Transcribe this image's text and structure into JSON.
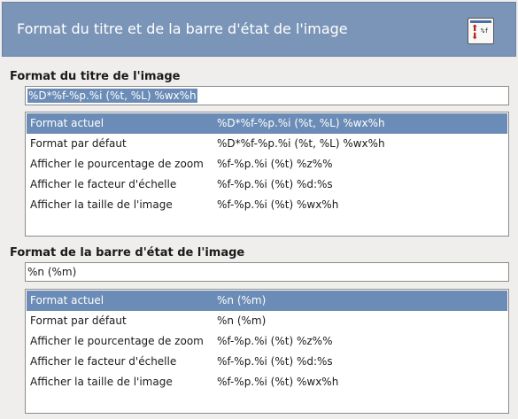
{
  "banner": {
    "title": "Format du titre et de la barre d'état de l'image",
    "icon": "title-format-icon"
  },
  "title_section": {
    "label": "Format du titre de l'image",
    "input_value": "%D*%f-%p.%i (%t, %L) %wx%h",
    "rows": [
      {
        "name": "Format actuel",
        "value": "%D*%f-%p.%i (%t, %L) %wx%h"
      },
      {
        "name": "Format par défaut",
        "value": "%D*%f-%p.%i (%t, %L) %wx%h"
      },
      {
        "name": "Afficher le pourcentage de zoom",
        "value": "%f-%p.%i (%t) %z%%"
      },
      {
        "name": "Afficher le facteur d'échelle",
        "value": "%f-%p.%i (%t) %d:%s"
      },
      {
        "name": "Afficher la taille de l'image",
        "value": "%f-%p.%i (%t) %wx%h"
      }
    ]
  },
  "status_section": {
    "label": "Format de la barre d'état de l'image",
    "input_value": "%n (%m)",
    "rows": [
      {
        "name": "Format actuel",
        "value": "%n (%m)"
      },
      {
        "name": "Format par défaut",
        "value": "%n (%m)"
      },
      {
        "name": "Afficher le pourcentage de zoom",
        "value": "%f-%p.%i (%t) %z%%"
      },
      {
        "name": "Afficher le facteur d'échelle",
        "value": "%f-%p.%i (%t) %d:%s"
      },
      {
        "name": "Afficher la taille de l'image",
        "value": "%f-%p.%i (%t) %wx%h"
      }
    ]
  },
  "colors": {
    "banner_bg": "#7b95b8",
    "selection": "#6b8cb6"
  }
}
